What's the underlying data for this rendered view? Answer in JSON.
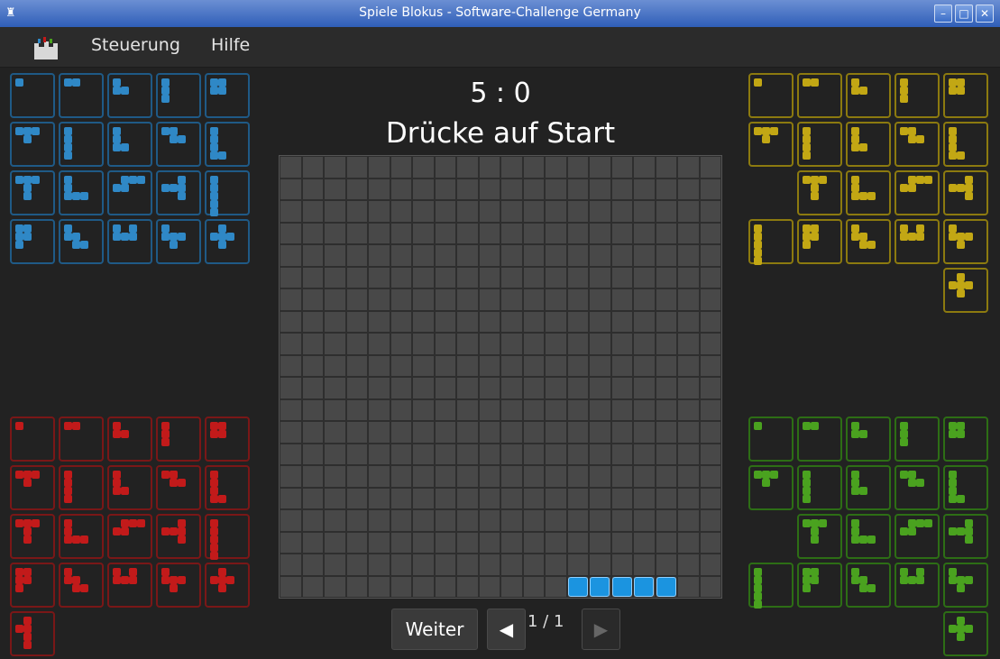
{
  "window": {
    "title": "Spiele Blokus - Software-Challenge Germany",
    "icon": "castle-icon",
    "buttons": [
      "minimize",
      "maximize",
      "close"
    ]
  },
  "menu": {
    "items": [
      "Steuerung",
      "Hilfe"
    ]
  },
  "game": {
    "score": "5 : 0",
    "status": "Drücke auf Start",
    "board_size": 20,
    "placed_color": "#1b94e0",
    "placed_cells": [
      [
        13,
        19
      ],
      [
        14,
        19
      ],
      [
        15,
        19
      ],
      [
        16,
        19
      ],
      [
        17,
        19
      ]
    ]
  },
  "controls": {
    "weiter_label": "Weiter",
    "prev_icon": "left-arrow-icon",
    "next_icon": "right-arrow-icon",
    "page_text": "1 / 1"
  },
  "players": {
    "blue": {
      "color": "#2f88c6",
      "pieces": 21
    },
    "yellow": {
      "color": "#c2a714",
      "pieces": 21
    },
    "red": {
      "color": "#c21a1a",
      "pieces": 21
    },
    "green": {
      "color": "#4aa21f",
      "pieces": 21
    }
  }
}
